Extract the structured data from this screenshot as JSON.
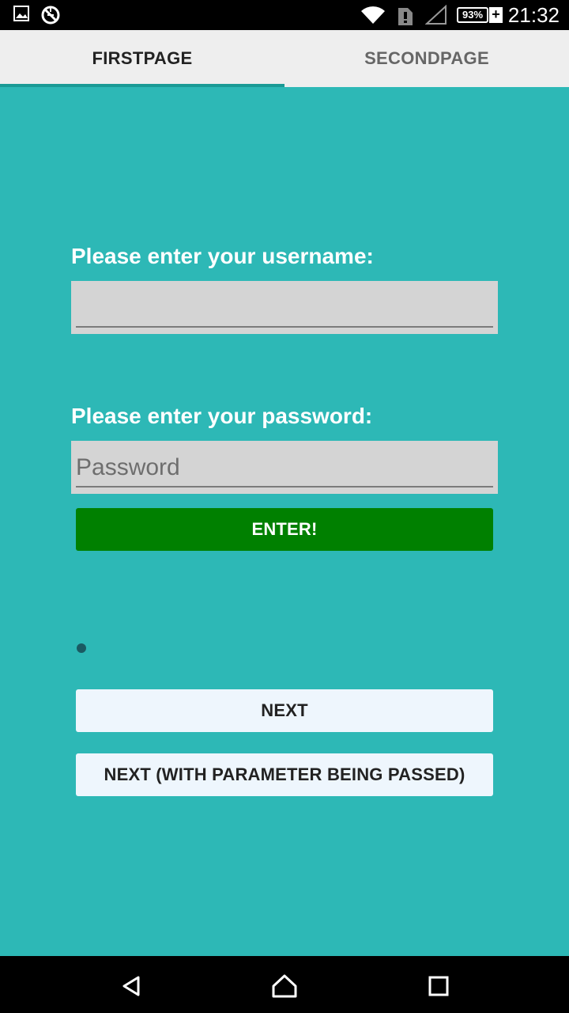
{
  "status_bar": {
    "time": "21:32",
    "battery_percent": "93%",
    "battery_charging": "+",
    "icons": [
      "image-icon",
      "sync-disabled-icon",
      "wifi-icon",
      "sim-alert-icon",
      "cell-signal-icon",
      "battery-icon"
    ]
  },
  "tabs": [
    {
      "label": "FIRSTPAGE",
      "selected": true
    },
    {
      "label": "SECONDPAGE",
      "selected": false
    }
  ],
  "form": {
    "username_label": "Please enter your username:",
    "username_value": "",
    "password_label": "Please enter your password:",
    "password_placeholder": "Password",
    "enter_button": "ENTER!"
  },
  "actions": {
    "next_button": "NEXT",
    "next_with_param_button": "NEXT (WITH PARAMETER BEING PASSED)"
  },
  "colors": {
    "background": "#2db8b6",
    "enter_button": "#008000",
    "tab_indicator": "#1a9a95"
  },
  "nav_bar": {
    "icons": [
      "back-icon",
      "home-icon",
      "recents-icon"
    ]
  }
}
